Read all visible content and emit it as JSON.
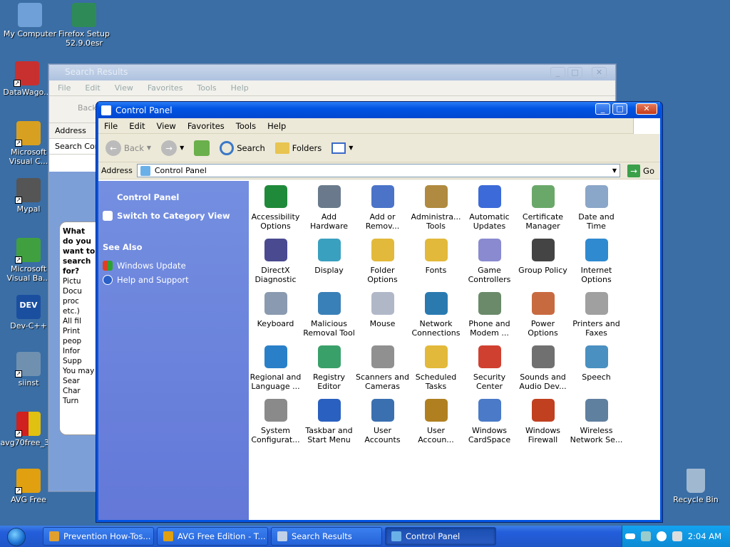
{
  "desktop": {
    "icons": [
      {
        "label": "My Computer",
        "color": "#6fa0d8"
      },
      {
        "label": "Firefox Setup 52.9.0esr",
        "color": "#2e8b57"
      },
      {
        "label": "DataWago...",
        "color": "#c83030"
      },
      {
        "label": "Microsoft Visual C...",
        "color": "#d8a020"
      },
      {
        "label": "Mypal",
        "color": "#555555"
      },
      {
        "label": "Microsoft Visual Ba...",
        "color": "#40a040"
      },
      {
        "label": "Dev-C++",
        "color": "#1a4fa0"
      },
      {
        "label": "siinst",
        "color": "#7090b0"
      },
      {
        "label": "avg70free_3...",
        "color": "#d02020"
      },
      {
        "label": "AVG Free",
        "color": "#e0a010"
      },
      {
        "label": "Recycle Bin",
        "color": "#a0b8d0"
      }
    ]
  },
  "search_window": {
    "title": "Search Results",
    "menu": [
      "File",
      "Edit",
      "View",
      "Favorites",
      "Tools",
      "Help"
    ],
    "back": "Back",
    "address": "Address",
    "search_com": "Search Com",
    "what_question": "What do you want to search for?",
    "options": [
      "Pictu",
      "Docu proc etc.)",
      "All fil",
      "Print peop",
      "Infor Supp"
    ],
    "you_may": "You may",
    "more": [
      "Sear",
      "Char",
      "Turn"
    ]
  },
  "window": {
    "title": "Control Panel",
    "menu": [
      "File",
      "Edit",
      "View",
      "Favorites",
      "Tools",
      "Help"
    ],
    "toolbar": {
      "back": "Back",
      "search": "Search",
      "folders": "Folders"
    },
    "address_label": "Address",
    "address_value": "Control Panel",
    "go": "Go",
    "taskpane": {
      "title": "Control Panel",
      "switch": "Switch to Category View",
      "see_also": "See Also",
      "links": [
        "Windows Update",
        "Help and Support"
      ]
    },
    "items": [
      {
        "label": "Accessibility Options",
        "icon": "accessibility-icon",
        "color": "#1f8a3a"
      },
      {
        "label": "Add Hardware",
        "icon": "hardware-icon",
        "color": "#6a7a8c"
      },
      {
        "label": "Add or Remov...",
        "icon": "add-remove-icon",
        "color": "#4b74c8"
      },
      {
        "label": "Administra... Tools",
        "icon": "admin-tools-icon",
        "color": "#b08a40"
      },
      {
        "label": "Automatic Updates",
        "icon": "windows-update-icon",
        "color": "#3c6ad8"
      },
      {
        "label": "Certificate Manager",
        "icon": "certificate-icon",
        "color": "#6aa86a"
      },
      {
        "label": "Date and Time",
        "icon": "clock-icon",
        "color": "#8aa6c8"
      },
      {
        "label": "DirectX Diagnostic",
        "icon": "directx-icon",
        "color": "#4a4a90"
      },
      {
        "label": "Display",
        "icon": "display-icon",
        "color": "#3aa0c0"
      },
      {
        "label": "Folder Options",
        "icon": "folder-options-icon",
        "color": "#e2b93a"
      },
      {
        "label": "Fonts",
        "icon": "fonts-icon",
        "color": "#e2b93a"
      },
      {
        "label": "Game Controllers",
        "icon": "gamepad-icon",
        "color": "#8a8ad0"
      },
      {
        "label": "Group Policy",
        "icon": "group-policy-icon",
        "color": "#444444"
      },
      {
        "label": "Internet Options",
        "icon": "internet-icon",
        "color": "#2f8ad0"
      },
      {
        "label": "Keyboard",
        "icon": "keyboard-icon",
        "color": "#8a9ab0"
      },
      {
        "label": "Malicious Removal Tool",
        "icon": "malware-tool-icon",
        "color": "#3a80b8"
      },
      {
        "label": "Mouse",
        "icon": "mouse-icon",
        "color": "#b0b8c8"
      },
      {
        "label": "Network Connections",
        "icon": "network-icon",
        "color": "#2a7ab0"
      },
      {
        "label": "Phone and Modem ...",
        "icon": "phone-icon",
        "color": "#6a8a6a"
      },
      {
        "label": "Power Options",
        "icon": "power-icon",
        "color": "#c86a40"
      },
      {
        "label": "Printers and Faxes",
        "icon": "printer-icon",
        "color": "#a0a0a0"
      },
      {
        "label": "Regional and Language ...",
        "icon": "globe-icon",
        "color": "#2a80c8"
      },
      {
        "label": "Registry Editor",
        "icon": "registry-icon",
        "color": "#3aa06a"
      },
      {
        "label": "Scanners and Cameras",
        "icon": "scanner-icon",
        "color": "#909090"
      },
      {
        "label": "Scheduled Tasks",
        "icon": "scheduled-tasks-icon",
        "color": "#e2b93a"
      },
      {
        "label": "Security Center",
        "icon": "shield-icon",
        "color": "#d04030"
      },
      {
        "label": "Sounds and Audio Dev...",
        "icon": "speaker-icon",
        "color": "#707070"
      },
      {
        "label": "Speech",
        "icon": "speech-icon",
        "color": "#4a90c0"
      },
      {
        "label": "System Configurat...",
        "icon": "system-config-icon",
        "color": "#8a8a8a"
      },
      {
        "label": "Taskbar and Start Menu",
        "icon": "taskbar-icon",
        "color": "#2a60c0"
      },
      {
        "label": "User Accounts",
        "icon": "users-icon",
        "color": "#3a70b0"
      },
      {
        "label": "User Accoun...",
        "icon": "user-key-icon",
        "color": "#b08020"
      },
      {
        "label": "Windows CardSpace",
        "icon": "cardspace-icon",
        "color": "#4a7ac8"
      },
      {
        "label": "Windows Firewall",
        "icon": "firewall-icon",
        "color": "#c04020"
      },
      {
        "label": "Wireless Network Se...",
        "icon": "wireless-icon",
        "color": "#6080a0"
      }
    ]
  },
  "taskbar": {
    "tasks": [
      "Prevention How-Tos...",
      "AVG Free Edition - T...",
      "Search Results",
      "Control Panel"
    ],
    "active": 3,
    "clock": "2:04 AM"
  }
}
